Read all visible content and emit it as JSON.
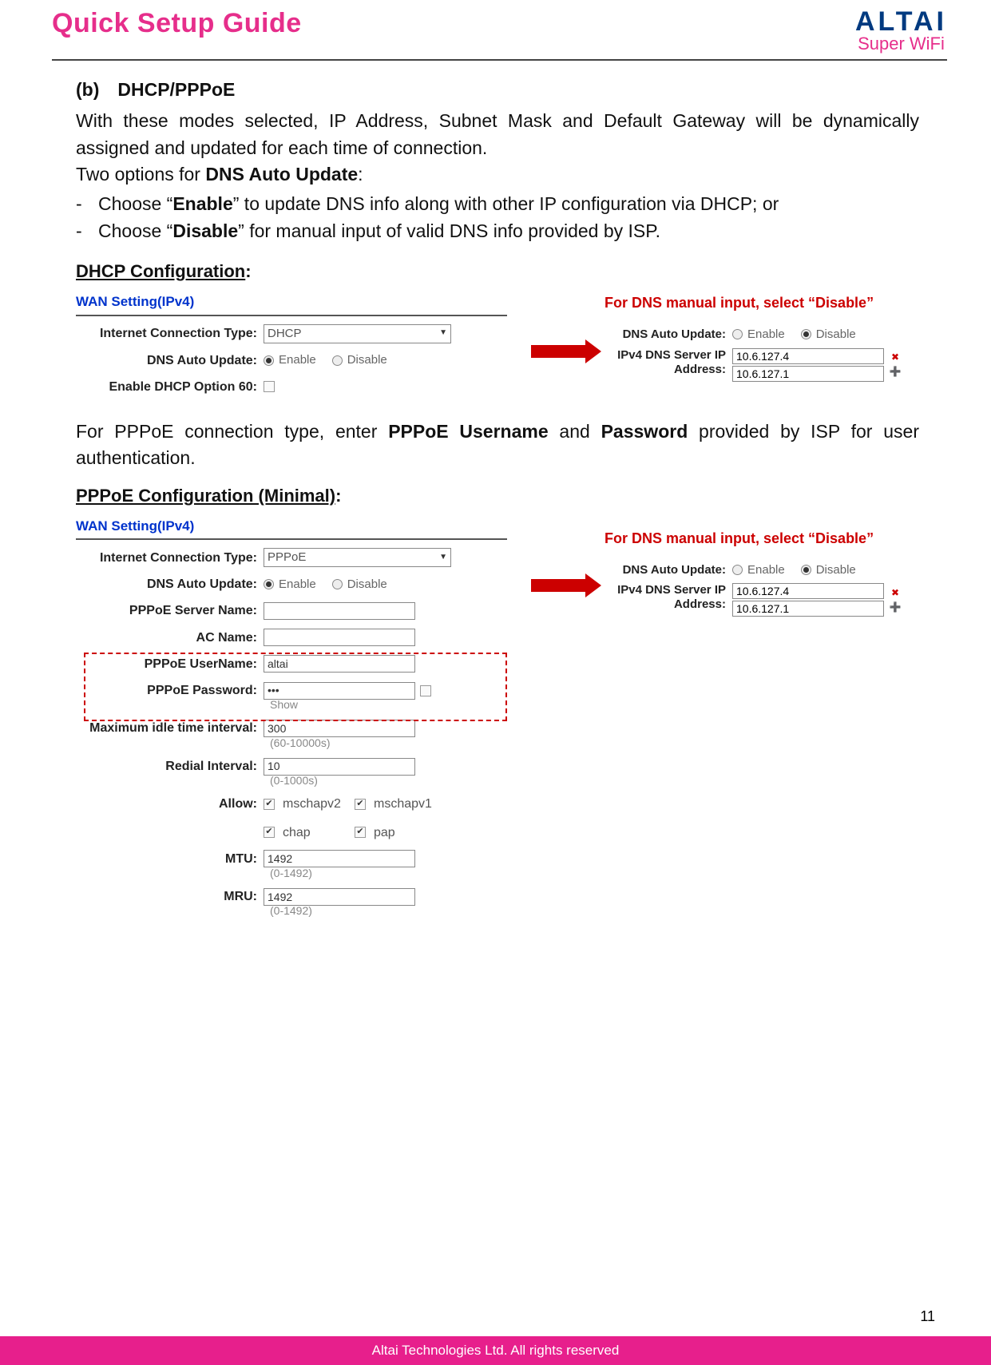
{
  "header": {
    "title": "Quick Setup Guide",
    "logo": "ALTAI",
    "logo_sub": "Super WiFi"
  },
  "section_b": {
    "heading": "(b) DHCP/PPPoE",
    "p1": "With these modes selected, IP Address, Subnet Mask and Default Gateway will be dynamically assigned and updated for each time of connection.",
    "p2_lead": "Two options for ",
    "p2_bold": "DNS Auto Update",
    "p2_tail": ":",
    "li1_a": "Choose “",
    "li1_b": "Enable",
    "li1_c": "” to update DNS info along with other IP configuration via DHCP; or",
    "li2_a": "Choose “",
    "li2_b": "Disable",
    "li2_c": "” for manual input of valid DNS info provided by ISP."
  },
  "dhcp": {
    "subhead": "DHCP Configuration",
    "wan_title": "WAN Setting(IPv4)",
    "lbl_conn": "Internet Connection Type:",
    "val_conn": "DHCP",
    "lbl_dns": "DNS Auto Update:",
    "opt_enable": "Enable",
    "opt_disable": "Disable",
    "lbl_opt60": "Enable DHCP Option 60:",
    "red_note": "For DNS manual input, select “Disable”",
    "lbl_dns2": "DNS Auto Update:",
    "lbl_ipv4": "IPv4 DNS Server IP Address:",
    "ip1": "10.6.127.4",
    "ip2": "10.6.127.1"
  },
  "mid": {
    "t1": "For PPPoE connection type, enter ",
    "b1": "PPPoE Username",
    "t2": " and ",
    "b2": "Password",
    "t3": " provided by ISP for user authentication."
  },
  "pppoe": {
    "subhead": "PPPoE Configuration (Minimal)",
    "wan_title": "WAN Setting(IPv4)",
    "lbl_conn": "Internet Connection Type:",
    "val_conn": "PPPoE",
    "lbl_dns": "DNS Auto Update:",
    "opt_enable": "Enable",
    "opt_disable": "Disable",
    "lbl_srv": "PPPoE Server Name:",
    "lbl_ac": "AC Name:",
    "lbl_user": "PPPoE UserName:",
    "val_user": "altai",
    "lbl_pass": "PPPoE Password:",
    "val_pass": "•••",
    "show": "Show",
    "lbl_idle": "Maximum idle time interval:",
    "val_idle": "300",
    "hint_idle": "(60-10000s)",
    "lbl_redial": "Redial Interval:",
    "val_redial": "10",
    "hint_redial": "(0-1000s)",
    "lbl_allow": "Allow:",
    "a1": "mschapv2",
    "a2": "mschapv1",
    "a3": "chap",
    "a4": "pap",
    "lbl_mtu": "MTU:",
    "val_mtu": "1492",
    "hint_mtu": "(0-1492)",
    "lbl_mru": "MRU:",
    "val_mru": "1492",
    "hint_mru": "(0-1492)",
    "red_note": "For DNS manual input, select “Disable”",
    "lbl_dns2": "DNS Auto Update:",
    "lbl_ipv4": "IPv4 DNS Server IP Address:",
    "ip1": "10.6.127.4",
    "ip2": "10.6.127.1"
  },
  "page_number": "11",
  "footer": "Altai Technologies Ltd. All rights reserved"
}
